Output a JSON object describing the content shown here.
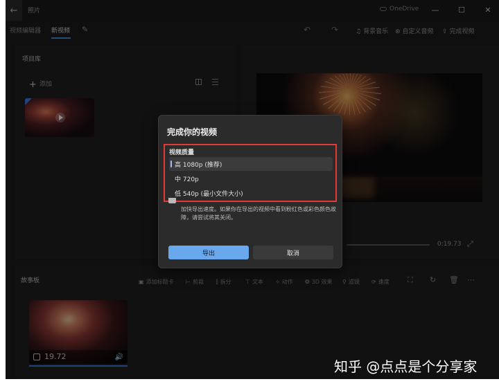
{
  "titlebar": {
    "app_title": "照片",
    "cloud_label": "OneDrive",
    "back_glyph": "←",
    "min_glyph": "—",
    "max_glyph": "☐",
    "close_glyph": "✕"
  },
  "tabs": {
    "project": "视频编辑器",
    "new_video": "新视频"
  },
  "toolbar": {
    "undo_glyph": "↶",
    "redo_glyph": "↷",
    "music": "背景音乐",
    "custom_audio": "自定义音频",
    "finish": "完成视频"
  },
  "library": {
    "title": "项目库",
    "add_label": "添加"
  },
  "preview": {
    "time_end": "0:19.73"
  },
  "storyboard": {
    "title": "故事板",
    "tools": [
      "添加标题卡",
      "剪裁",
      "拆分",
      "文本",
      "动作",
      "3D 效果",
      "滤镜",
      "速度"
    ],
    "clip_duration": "19.72"
  },
  "dialog": {
    "title": "完成你的视频",
    "quality_label": "视频质量",
    "options": [
      "高 1080p (推荐)",
      "中 720p",
      "低 540p (最小文件大小)"
    ],
    "selected": 0,
    "accel_text": "加快导出速度。如果你在导出的视频中看到粉红色或彩色颜色故障，请尝试将其关闭。",
    "export_label": "导出",
    "cancel_label": "取消"
  },
  "watermark": "知乎 @点点是个分享家",
  "colors": {
    "accent": "#6aa8ee",
    "highlight_border": "#e23a3a",
    "background": "#1c1c1c"
  }
}
